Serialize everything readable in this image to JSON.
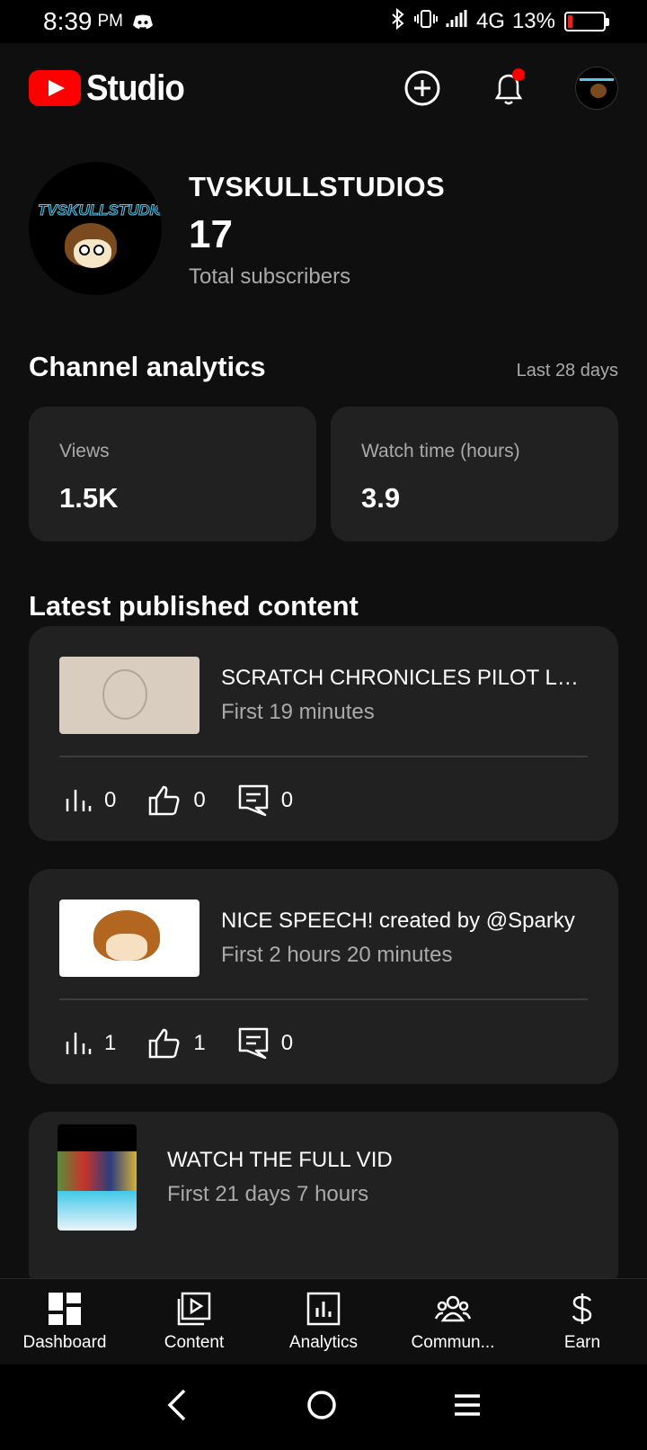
{
  "status_bar": {
    "time": "8:39",
    "ampm": "PM",
    "network": "4G",
    "battery": "13%",
    "battery_level": 0.13,
    "battery_color": "#e0261f"
  },
  "header": {
    "app_name": "Studio",
    "brand_color": "#ff0000",
    "icons": [
      "create-icon",
      "bell-icon",
      "account-avatar"
    ]
  },
  "channel": {
    "name": "TVSKULLSTUDIOS",
    "avatar_text": "TVSKULLSTUDIOS",
    "subscribers": "17",
    "subscribers_label": "Total subscribers"
  },
  "analytics": {
    "title": "Channel analytics",
    "period": "Last 28 days",
    "cards": [
      {
        "label": "Views",
        "value": "1.5K"
      },
      {
        "label": "Watch time (hours)",
        "value": "3.9"
      }
    ]
  },
  "latest": {
    "title": "Latest published content",
    "items": [
      {
        "title": "SCRATCH CHRONICLES PILOT LEAKED",
        "subtitle": "First 19 minutes",
        "views": "0",
        "likes": "0",
        "comments": "0"
      },
      {
        "title": "NICE SPEECH! created by @Sparky",
        "subtitle": "First 2 hours 20 minutes",
        "views": "1",
        "likes": "1",
        "comments": "0"
      },
      {
        "title": "WATCH THE FULL VID",
        "subtitle": "First 21 days 7 hours"
      }
    ]
  },
  "bottom_nav": [
    {
      "label": "Dashboard",
      "icon": "dashboard-icon"
    },
    {
      "label": "Content",
      "icon": "content-icon"
    },
    {
      "label": "Analytics",
      "icon": "analytics-icon"
    },
    {
      "label": "Commun...",
      "icon": "community-icon"
    },
    {
      "label": "Earn",
      "icon": "earn-icon"
    }
  ]
}
